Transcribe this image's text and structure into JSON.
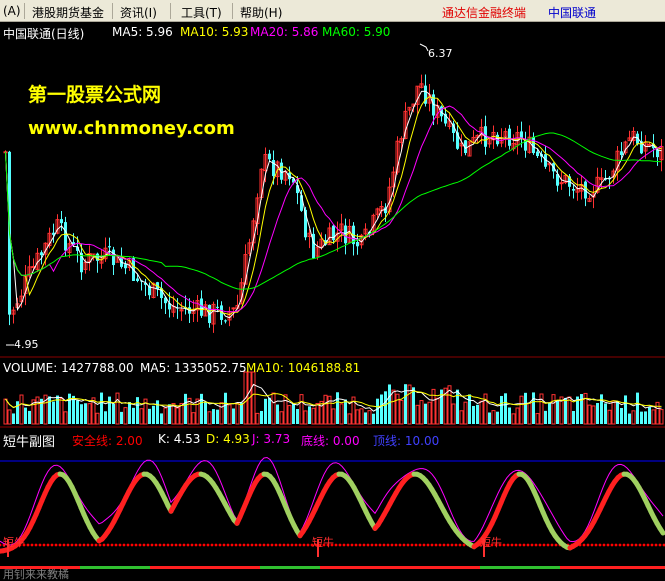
{
  "menu": {
    "items": [
      {
        "label": "(A)"
      },
      {
        "label": "港股期货基金"
      },
      {
        "label": "资讯(I)"
      },
      {
        "label": "工具(T)"
      },
      {
        "label": "帮助(H)"
      }
    ],
    "right_links": [
      {
        "label": "通达信金融终端",
        "color": "#e00000"
      },
      {
        "label": "中国联通",
        "color": "#0000cc"
      }
    ]
  },
  "price_panel": {
    "title": "中国联通(日线)",
    "ma5": "MA5: 5.96",
    "ma10": "MA10: 5.93",
    "ma20": "MA20: 5.86",
    "ma60": "MA60: 5.90",
    "high_label": "6.37",
    "low_label": "4.95",
    "watermark_cn": "第一股票公式网",
    "watermark_url": "www.chnmoney.com"
  },
  "volume_panel": {
    "volume": "VOLUME: 1427788.00",
    "ma5": "MA5: 1335052.75",
    "ma10": "MA10: 1046188.81"
  },
  "indicator_panel": {
    "title": "短牛副图",
    "safety_line": "安全线: 2.00",
    "k": "K: 4.53",
    "d": "D: 4.93",
    "j": "J: 3.73",
    "bottom_line": "底线: 0.00",
    "top_line": "顶线: 10.00",
    "marker_text": "短牛",
    "footer_text": "用钊来来教橘"
  },
  "colors": {
    "up": "#ff3232",
    "down": "#54ffff",
    "ma5": "#ffffff",
    "ma10": "#ffff00",
    "ma20": "#ff00ff",
    "ma60": "#00ff00",
    "k_line": "#ff2020",
    "d_line": "#a0d060",
    "j_line": "#ff00ff",
    "top_line": "#0000ff",
    "safety": "#ff0000"
  }
}
